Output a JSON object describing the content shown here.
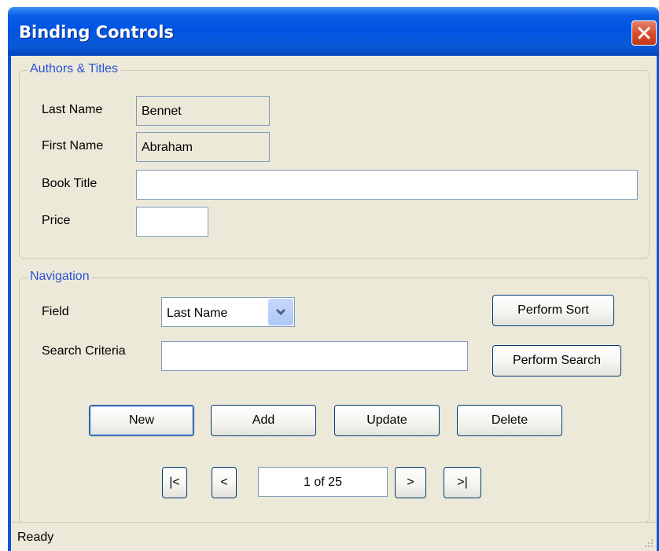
{
  "window": {
    "title": "Binding Controls"
  },
  "authors_group": {
    "legend": "Authors & Titles",
    "last_name_label": "Last Name",
    "last_name_value": "Bennet",
    "first_name_label": "First Name",
    "first_name_value": "Abraham",
    "book_title_label": "Book Title",
    "book_title_value": "",
    "price_label": "Price",
    "price_value": ""
  },
  "navigation_group": {
    "legend": "Navigation",
    "field_label": "Field",
    "field_selected": "Last Name",
    "search_label": "Search Criteria",
    "search_value": "",
    "sort_button": "Perform Sort",
    "search_button": "Perform Search",
    "new_button": "New",
    "add_button": "Add",
    "update_button": "Update",
    "delete_button": "Delete",
    "first_button": "|<",
    "prev_button": "<",
    "position": "1 of 25",
    "next_button": ">",
    "last_button": ">|"
  },
  "status": {
    "text": "Ready"
  },
  "colors": {
    "titlebar": "#0054e3",
    "legend": "#2a52dc",
    "window_bg": "#ece9d8",
    "close": "#d84a28"
  }
}
